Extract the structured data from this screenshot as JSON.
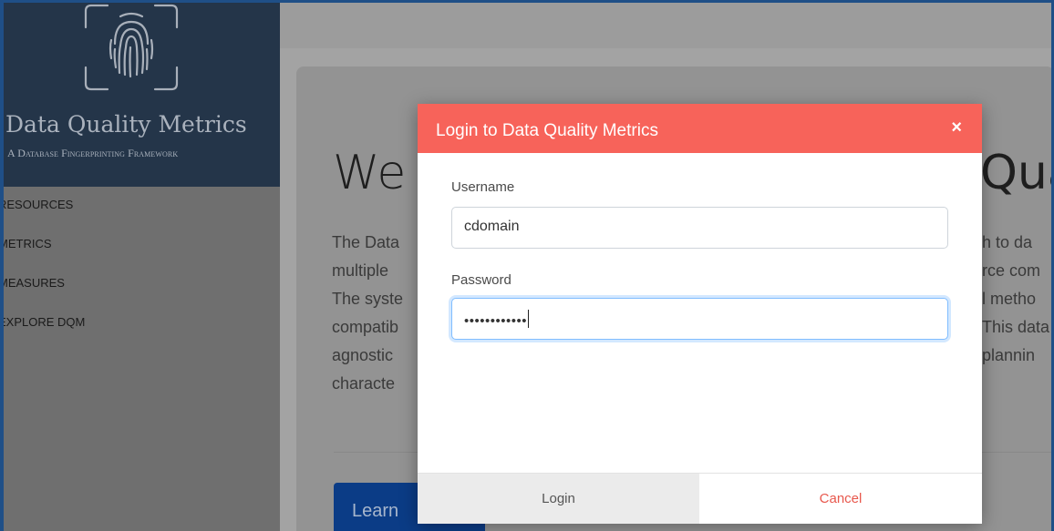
{
  "app": {
    "brand_title": "Data Quality Metrics",
    "brand_subtitle": "A Database Fingerprinting Framework",
    "logo_icon": "fingerprint-icon"
  },
  "sidebar": {
    "items": [
      {
        "label": "RESOURCES"
      },
      {
        "label": "METRICS"
      },
      {
        "label": "MEASURES"
      },
      {
        "label": "EXPLORE DQM"
      }
    ]
  },
  "hero": {
    "title_visible_left": "We",
    "title_visible_right": "Qua",
    "lead_left": [
      "The Data",
      "multiple",
      "The syste",
      "compatib",
      "agnostic",
      "characte"
    ],
    "lead_right": [
      "h to da",
      "rce com",
      "l metho",
      "This data",
      "plannin"
    ],
    "learn_button": "Learn"
  },
  "modal": {
    "title": "Login to Data Quality Metrics",
    "close_glyph": "×",
    "username_label": "Username",
    "username_value": "cdomain",
    "password_label": "Password",
    "password_mask": "••••••••••••",
    "login_label": "Login",
    "cancel_label": "Cancel"
  },
  "colors": {
    "header": "#f7635a",
    "brand_bg": "#243549",
    "cancel_text": "#e8584d",
    "learn_button_bg": "#0b3c86"
  }
}
